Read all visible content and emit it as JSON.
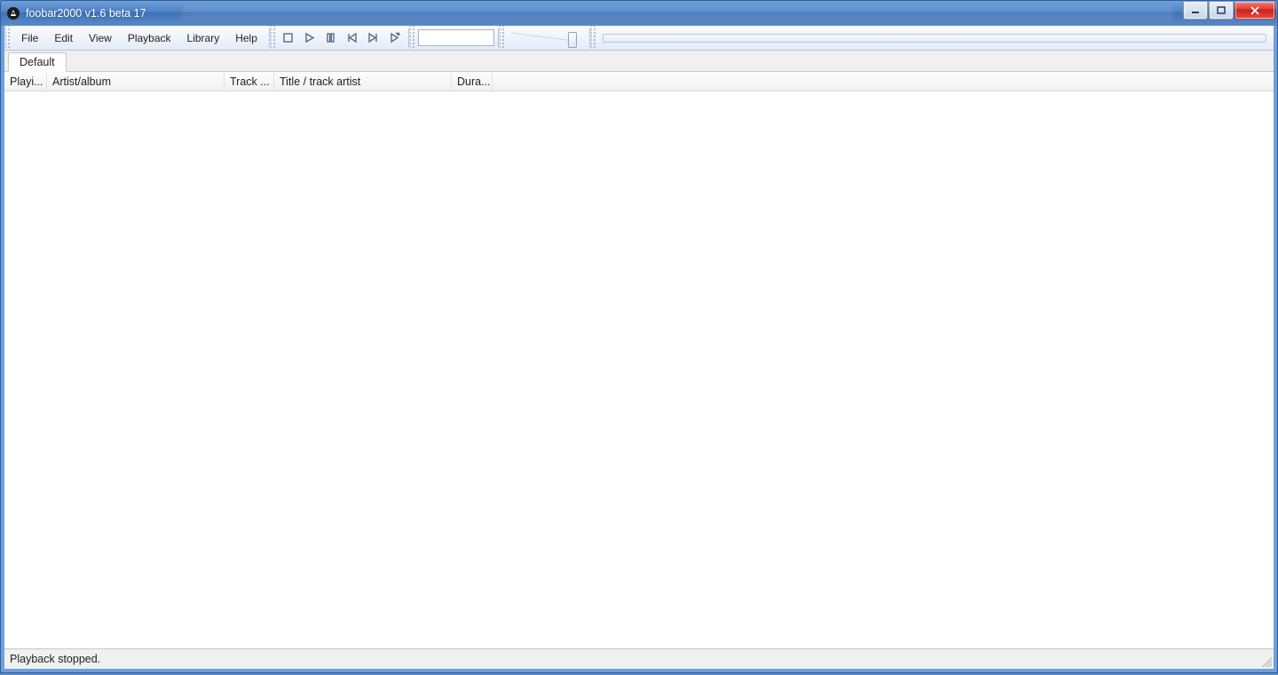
{
  "window": {
    "title": "foobar2000 v1.6 beta 17"
  },
  "menu": {
    "file": "File",
    "edit": "Edit",
    "view": "View",
    "playback": "Playback",
    "library": "Library",
    "help": "Help"
  },
  "search": {
    "value": ""
  },
  "tabs": [
    {
      "label": "Default"
    }
  ],
  "columns": {
    "playing": "Playi...",
    "artist_album": "Artist/album",
    "track_no": "Track ...",
    "title_artist": "Title / track artist",
    "duration": "Dura..."
  },
  "status": {
    "text": "Playback stopped."
  }
}
